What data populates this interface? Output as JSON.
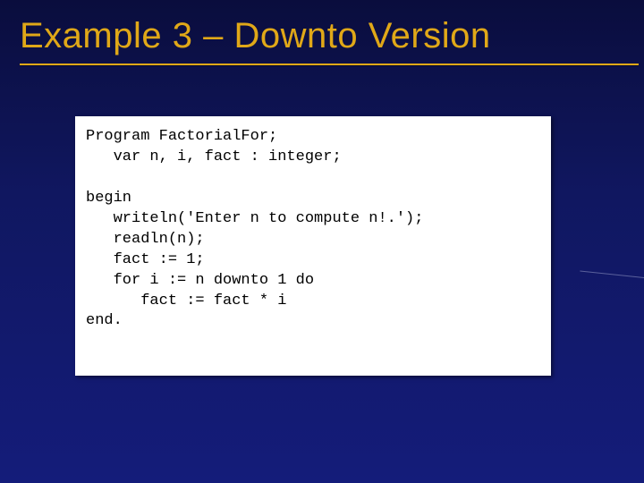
{
  "title": "Example 3 – Downto Version",
  "code": {
    "l1": "Program FactorialFor;",
    "l2": "   var n, i, fact : integer;",
    "l3": "",
    "l4": "begin",
    "l5": "   writeln('Enter n to compute n!.');",
    "l6": "   readln(n);",
    "l7": "   fact := 1;",
    "l8": "   for i := n downto 1 do",
    "l9": "      fact := fact * i",
    "l10": "end."
  }
}
